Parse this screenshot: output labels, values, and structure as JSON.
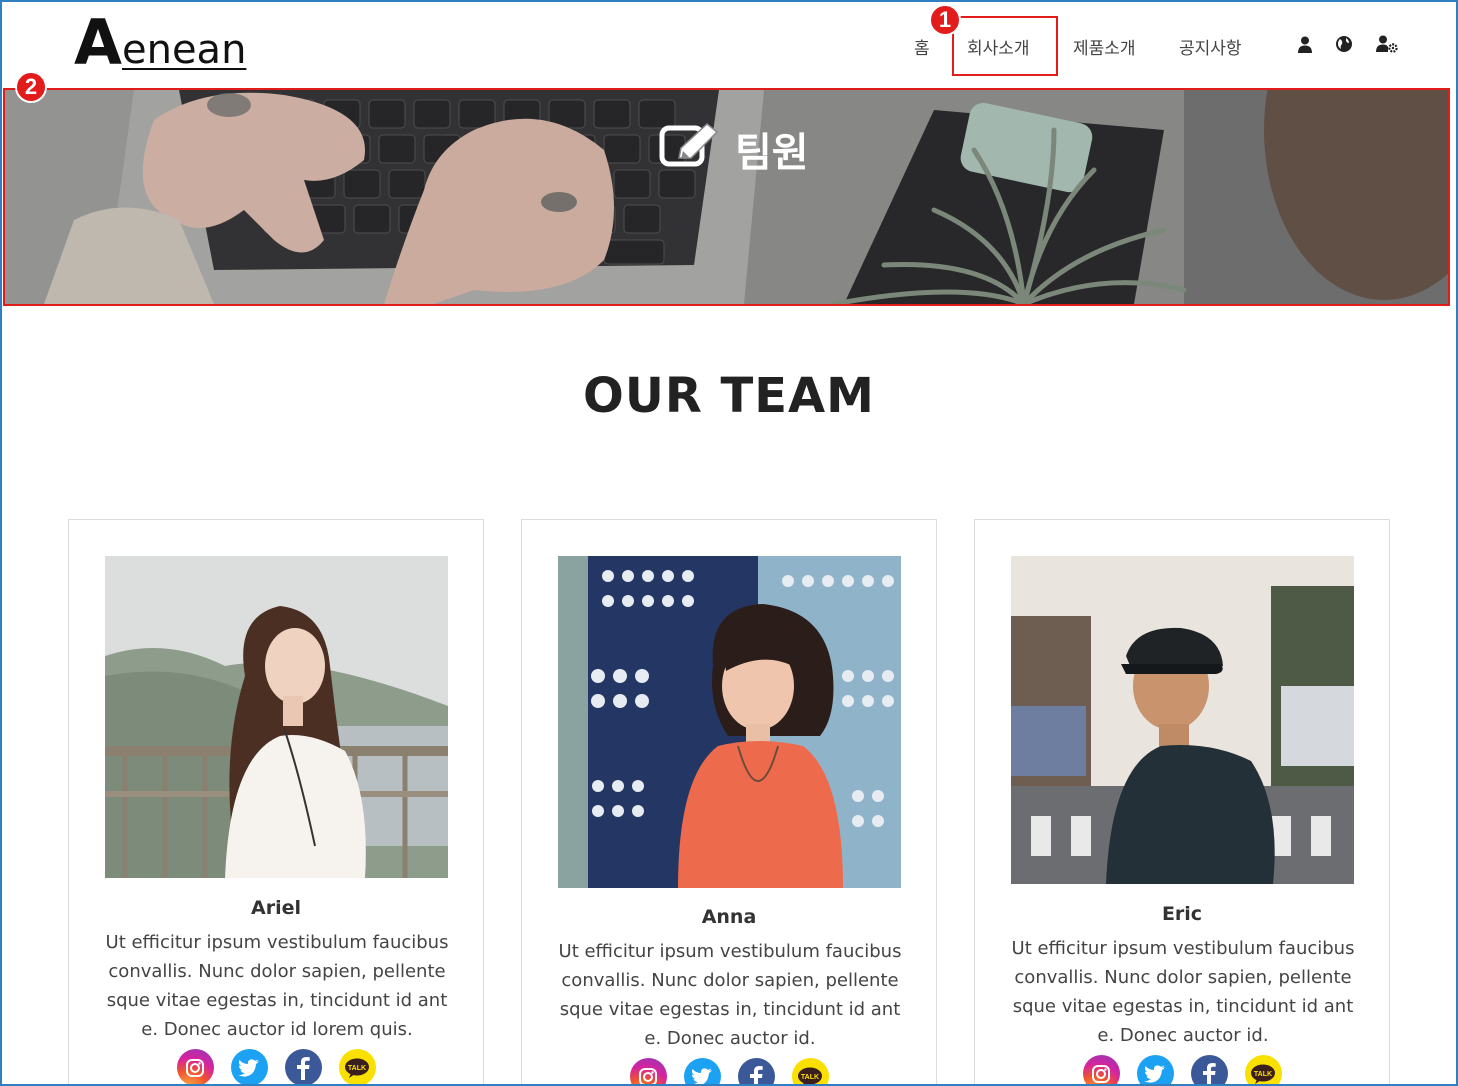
{
  "header": {
    "logo_initial": "A",
    "logo_rest": "enean",
    "nav": [
      {
        "label": "홈"
      },
      {
        "label": "회사소개"
      },
      {
        "label": "제품소개"
      },
      {
        "label": "공지사항"
      }
    ],
    "icons": [
      "user-icon",
      "globe-icon",
      "user-settings-icon"
    ]
  },
  "annotations": [
    {
      "label": "1"
    },
    {
      "label": "2"
    }
  ],
  "hero": {
    "title": "팀원",
    "icon": "edit-icon"
  },
  "section": {
    "title": "OUR TEAM"
  },
  "team": [
    {
      "name": "Ariel",
      "description": "Ut efficitur ipsum vestibulum faucibus convallis. Nunc dolor sapien, pellente sque vitae egestas in, tincidunt id ant e. Donec auctor id lorem quis."
    },
    {
      "name": "Anna",
      "description": "Ut efficitur ipsum vestibulum faucibus convallis. Nunc dolor sapien, pellente sque vitae egestas in, tincidunt id ant e. Donec auctor id."
    },
    {
      "name": "Eric",
      "description": "Ut efficitur ipsum vestibulum faucibus convallis. Nunc dolor sapien, pellente sque vitae egestas in, tincidunt id ant e. Donec auctor id."
    }
  ],
  "social_icons": [
    "instagram-icon",
    "twitter-icon",
    "facebook-icon",
    "kakaotalk-icon"
  ],
  "social_kakao_text": "TALK",
  "colors": {
    "annotation_red": "#e21b1b",
    "frame_blue": "#2f7fc1",
    "twitter": "#1da1f2",
    "facebook": "#3b5998",
    "kakao": "#f9e000"
  }
}
